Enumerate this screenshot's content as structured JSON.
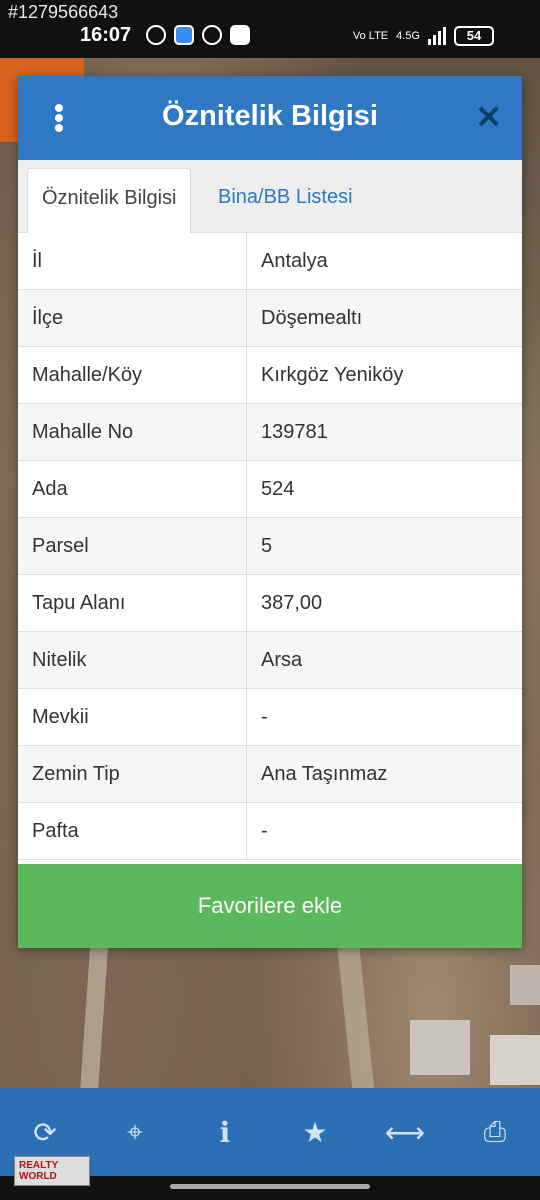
{
  "status_bar": {
    "watermark": "#1279566643",
    "time": "16:07",
    "network": "4.5G",
    "volte": "Vo LTE",
    "battery": "54"
  },
  "dialog": {
    "title": "Öznitelik Bilgisi",
    "tabs": [
      {
        "label": "Öznitelik Bilgisi",
        "active": true
      },
      {
        "label": "Bina/BB Listesi",
        "active": false
      }
    ],
    "rows": [
      {
        "key": "İl",
        "value": "Antalya"
      },
      {
        "key": "İlçe",
        "value": "Döşemealtı"
      },
      {
        "key": "Mahalle/Köy",
        "value": "Kırkgöz Yeniköy"
      },
      {
        "key": "Mahalle No",
        "value": "139781"
      },
      {
        "key": "Ada",
        "value": "524"
      },
      {
        "key": "Parsel",
        "value": "5"
      },
      {
        "key": "Tapu Alanı",
        "value": "387,00"
      },
      {
        "key": "Nitelik",
        "value": "Arsa"
      },
      {
        "key": "Mevkii",
        "value": "-"
      },
      {
        "key": "Zemin Tip",
        "value": "Ana Taşınmaz"
      },
      {
        "key": "Pafta",
        "value": "-"
      }
    ],
    "favorite_button": "Favorilere ekle"
  },
  "toolbar": {
    "icons": [
      "refresh-icon",
      "locate-icon",
      "info-icon",
      "star-icon",
      "measure-icon",
      "print-icon"
    ]
  },
  "logo": {
    "line1": "REALTY",
    "line2": "WORLD"
  },
  "colors": {
    "header_blue": "#2f78c4",
    "button_green": "#5cb85c",
    "toolbar_blue": "#2d6fb5"
  }
}
